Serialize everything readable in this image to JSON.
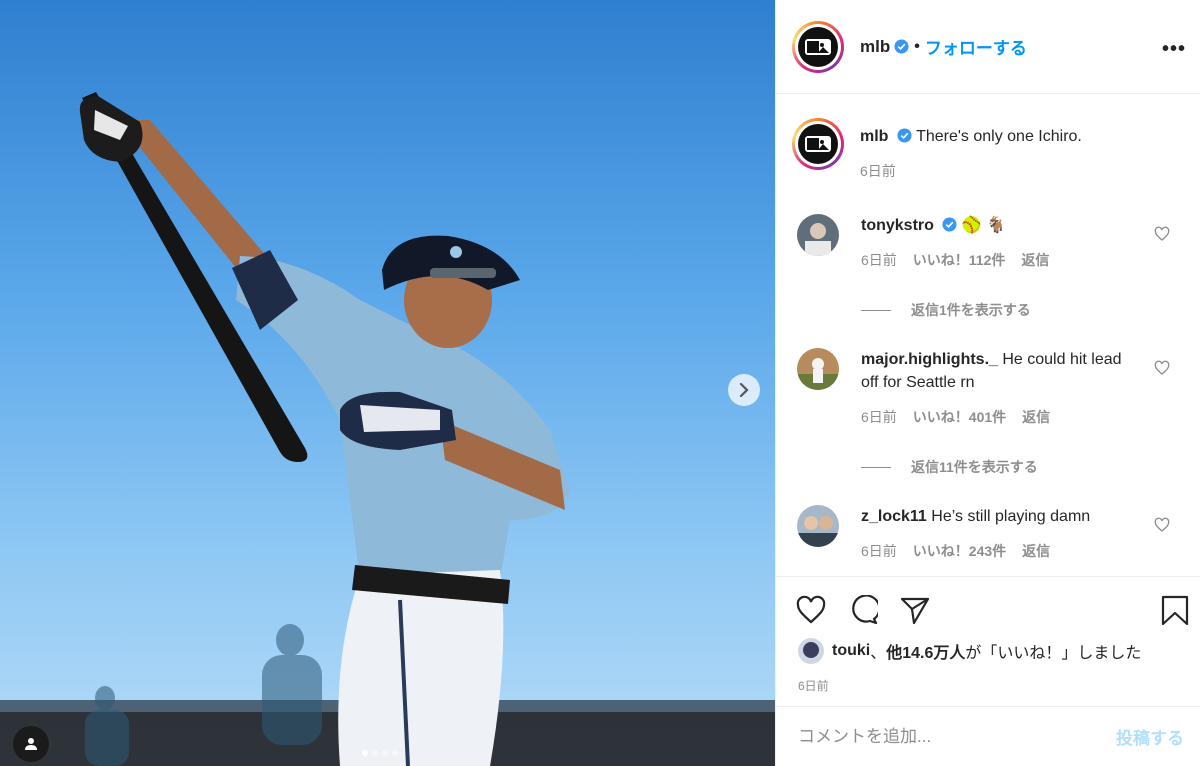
{
  "header": {
    "username": "mlb",
    "separator": "•",
    "follow_label": "フォローする",
    "more_label": "•••"
  },
  "caption": {
    "username": "mlb",
    "text": "There's only one Ichiro.",
    "time": "6日前"
  },
  "comments": [
    {
      "username": "tonykstro",
      "verified": true,
      "text": "🥎 🐐",
      "time": "6日前",
      "likes": "いいね！112件",
      "reply_label": "返信",
      "view_replies": "返信1件を表示する"
    },
    {
      "username": "major.highlights._",
      "verified": false,
      "text": "He could hit lead off for Seattle rn",
      "time": "6日前",
      "likes": "いいね！401件",
      "reply_label": "返信",
      "view_replies": "返信11件を表示する"
    },
    {
      "username": "z_lock11",
      "verified": false,
      "text": "He’s still playing damn",
      "time": "6日前",
      "likes": "いいね！243件",
      "reply_label": "返信"
    }
  ],
  "likes_summary": {
    "user": "touki",
    "sep": "、",
    "others": "他14.6万人",
    "suffix": "が「いいね！」しました"
  },
  "post_time": "6日前",
  "add_comment": {
    "placeholder": "コメントを追加...",
    "post_label": "投稿する"
  },
  "carousel": {
    "slide_count": 4,
    "active_index": 0
  },
  "colors": {
    "accent": "#0095f6",
    "verified_badge": "#3897f0",
    "muted_text": "#8e8e8e",
    "post_disabled": "#b2dffc"
  },
  "icons": {
    "next": "chevron-right-icon",
    "tag": "user-icon",
    "like": "heart-icon",
    "comment": "comment-bubble-icon",
    "share": "paper-plane-icon",
    "save": "bookmark-icon"
  }
}
